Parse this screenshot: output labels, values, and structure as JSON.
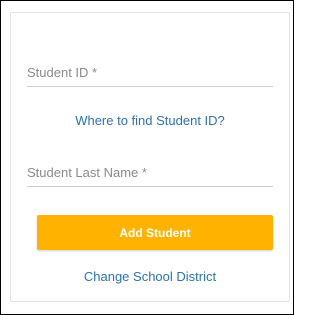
{
  "form": {
    "student_id": {
      "value": "",
      "placeholder": "Student ID *"
    },
    "find_link": "Where to find Student ID?",
    "last_name": {
      "value": "",
      "placeholder": "Student Last Name *"
    },
    "add_button": "Add Student",
    "change_district_link": "Change School District"
  },
  "colors": {
    "accent": "#ffb300",
    "link": "#2a72b5"
  }
}
